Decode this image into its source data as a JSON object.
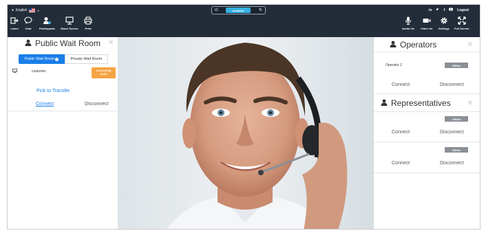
{
  "header": {
    "language": "English",
    "status": "Available",
    "social": [
      "in",
      "t",
      "f",
      "yt"
    ],
    "logout": "Logout",
    "left_tools": [
      {
        "label": "Leave",
        "icon": "exit-icon"
      },
      {
        "label": "Chat",
        "icon": "chat-bubble-icon"
      },
      {
        "label": "Participants",
        "icon": "participants-icon"
      },
      {
        "label": "Share Screen",
        "icon": "monitor-icon"
      },
      {
        "label": "Print",
        "icon": "printer-icon"
      }
    ],
    "right_tools": [
      {
        "label": "Audio On",
        "icon": "microphone-icon"
      },
      {
        "label": "Video On",
        "icon": "video-camera-icon"
      },
      {
        "label": "Settings",
        "icon": "gear-icon"
      },
      {
        "label": "Full Screen",
        "icon": "fullscreen-icon"
      }
    ]
  },
  "wait_room": {
    "title": "Public Wait Room",
    "tabs": {
      "public": "Public Wait Room",
      "private": "Private Wait Room"
    },
    "tab_badge": "?",
    "customer": {
      "name": "customer",
      "status_line1": "Connecting",
      "status_line2": "00:30"
    },
    "pick": "Pick to Transfer",
    "connect": "Connect",
    "disconnect": "Disconnect"
  },
  "operators": {
    "title": "Operators",
    "items": [
      {
        "name": "Operator 2",
        "status": "Offline",
        "connect": "Connect",
        "disconnect": "Disconnect"
      }
    ]
  },
  "representatives": {
    "title": "Representatives",
    "items": [
      {
        "status": "Offline",
        "connect": "Connect",
        "disconnect": "Disconnect"
      },
      {
        "status": "Offline",
        "connect": "Connect",
        "disconnect": "Disconnect"
      }
    ]
  },
  "colors": {
    "header_bg": "#222d39",
    "accent": "#1a7ee8",
    "status_pill": "#35b1e2",
    "connecting": "#f5a443",
    "offline": "#8b9097"
  }
}
